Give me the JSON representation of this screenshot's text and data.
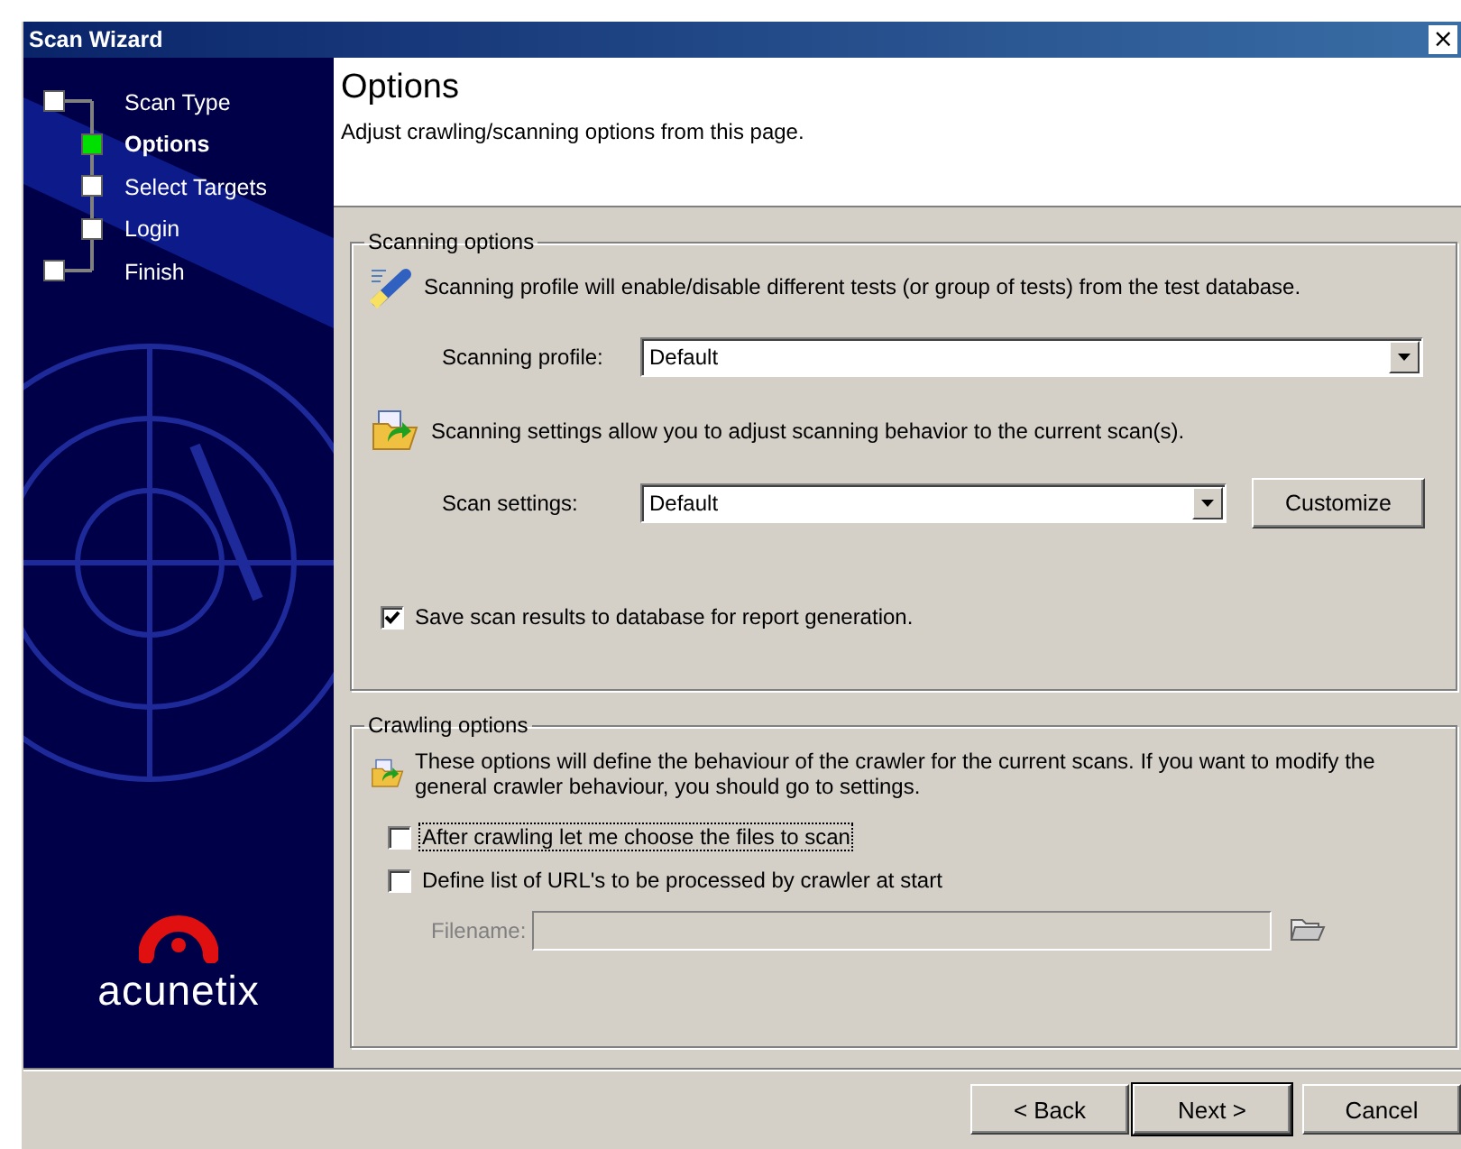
{
  "window": {
    "title": "Scan Wizard",
    "close": "×"
  },
  "steps": [
    {
      "label": "Scan Type",
      "kind": "end",
      "selected": false
    },
    {
      "label": "Options",
      "kind": "inner",
      "selected": true
    },
    {
      "label": "Select Targets",
      "kind": "inner",
      "selected": false
    },
    {
      "label": "Login",
      "kind": "inner",
      "selected": false
    },
    {
      "label": "Finish",
      "kind": "end",
      "selected": false
    }
  ],
  "logo": {
    "text": "acunetix"
  },
  "page": {
    "title": "Options",
    "subtitle": "Adjust crawling/scanning options from this page."
  },
  "scanning_options": {
    "title": "Scanning options",
    "profile_note": "Scanning profile will enable/disable different tests (or group of tests) from the test database.",
    "profile_label": "Scanning profile:",
    "profile_value": "Default",
    "settings_note": "Scanning settings allow you to adjust scanning behavior to the current scan(s).",
    "settings_label": "Scan settings:",
    "settings_value": "Default",
    "customize": "Customize",
    "save_results": {
      "label": "Save scan results to database for report generation.",
      "checked": true
    }
  },
  "crawling_options": {
    "title": "Crawling options",
    "note": "These options will define the behaviour of the crawler for the current scans. If you want to modify the general crawler behaviour, you should go to settings.",
    "options": [
      {
        "label": "After crawling let me choose the files to scan",
        "checked": false,
        "focused": true
      },
      {
        "label": "Define list of URL's to be processed by crawler at start",
        "checked": false,
        "focused": false
      }
    ],
    "filename": {
      "label": "Filename:",
      "disabled": true
    }
  },
  "buttons": [
    {
      "label": "< Back",
      "default": false
    },
    {
      "label": "Next >",
      "default": true
    },
    {
      "label": "Cancel",
      "default": false
    }
  ]
}
